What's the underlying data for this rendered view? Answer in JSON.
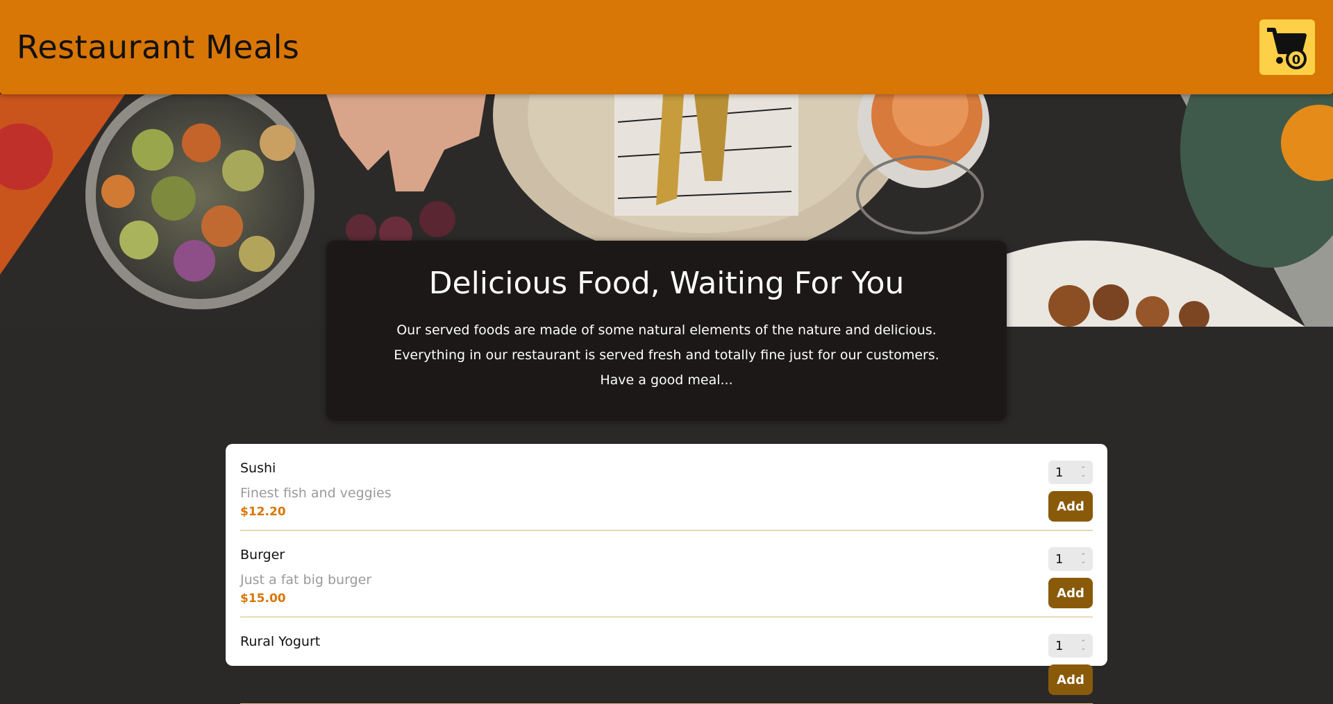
{
  "header": {
    "title": "Restaurant Meals",
    "cart_count": "0",
    "cart_icon": "shopping-cart-icon"
  },
  "colors": {
    "header_bg": "#d87606",
    "cart_button_bg": "#fdd047",
    "page_bg": "#2b2828",
    "summary_bg": "#1b1817",
    "price": "#d87606",
    "add_button": "#8a5a0b"
  },
  "summary": {
    "heading": "Delicious Food, Waiting For You",
    "line1": "Our served foods are made of some natural elements of the nature and delicious.",
    "line2": "Everything in our restaurant is served fresh and totally fine just for our customers.",
    "line3": "Have a good meal..."
  },
  "meals": [
    {
      "name": "Sushi",
      "description": "Finest fish and veggies",
      "price": "$12.20",
      "quantity": "1",
      "add_label": "Add"
    },
    {
      "name": "Burger",
      "description": "Just a fat big burger",
      "price": "$15.00",
      "quantity": "1",
      "add_label": "Add"
    },
    {
      "name": "Rural Yogurt",
      "description": "",
      "price": "",
      "quantity": "1",
      "add_label": "Add"
    }
  ]
}
